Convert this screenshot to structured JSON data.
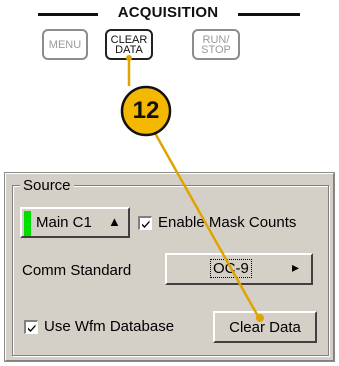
{
  "acquisition": {
    "title": "ACQUISITION",
    "buttons": [
      {
        "line1": "MENU",
        "line2": ""
      },
      {
        "line1": "CLEAR",
        "line2": "DATA"
      },
      {
        "line1": "RUN/",
        "line2": "STOP"
      }
    ]
  },
  "callout": {
    "number": "12"
  },
  "source_panel": {
    "group_label": "Source",
    "source_button": "Main C1",
    "source_arrow": "▲",
    "enable_mask_counts": {
      "label": "Enable Mask Counts",
      "checked": true
    },
    "comm_standard": {
      "label": "Comm Standard",
      "value": "OC-9",
      "arrow": "▸"
    },
    "use_wfm_database": {
      "label": "Use Wfm Database",
      "checked": true
    },
    "clear_data_button": "Clear Data"
  },
  "colors": {
    "callout_fill": "#f5b800",
    "callout_line": "#e0a400",
    "indicator_green": "#00e000",
    "panel_bg": "#d4d0c8"
  }
}
